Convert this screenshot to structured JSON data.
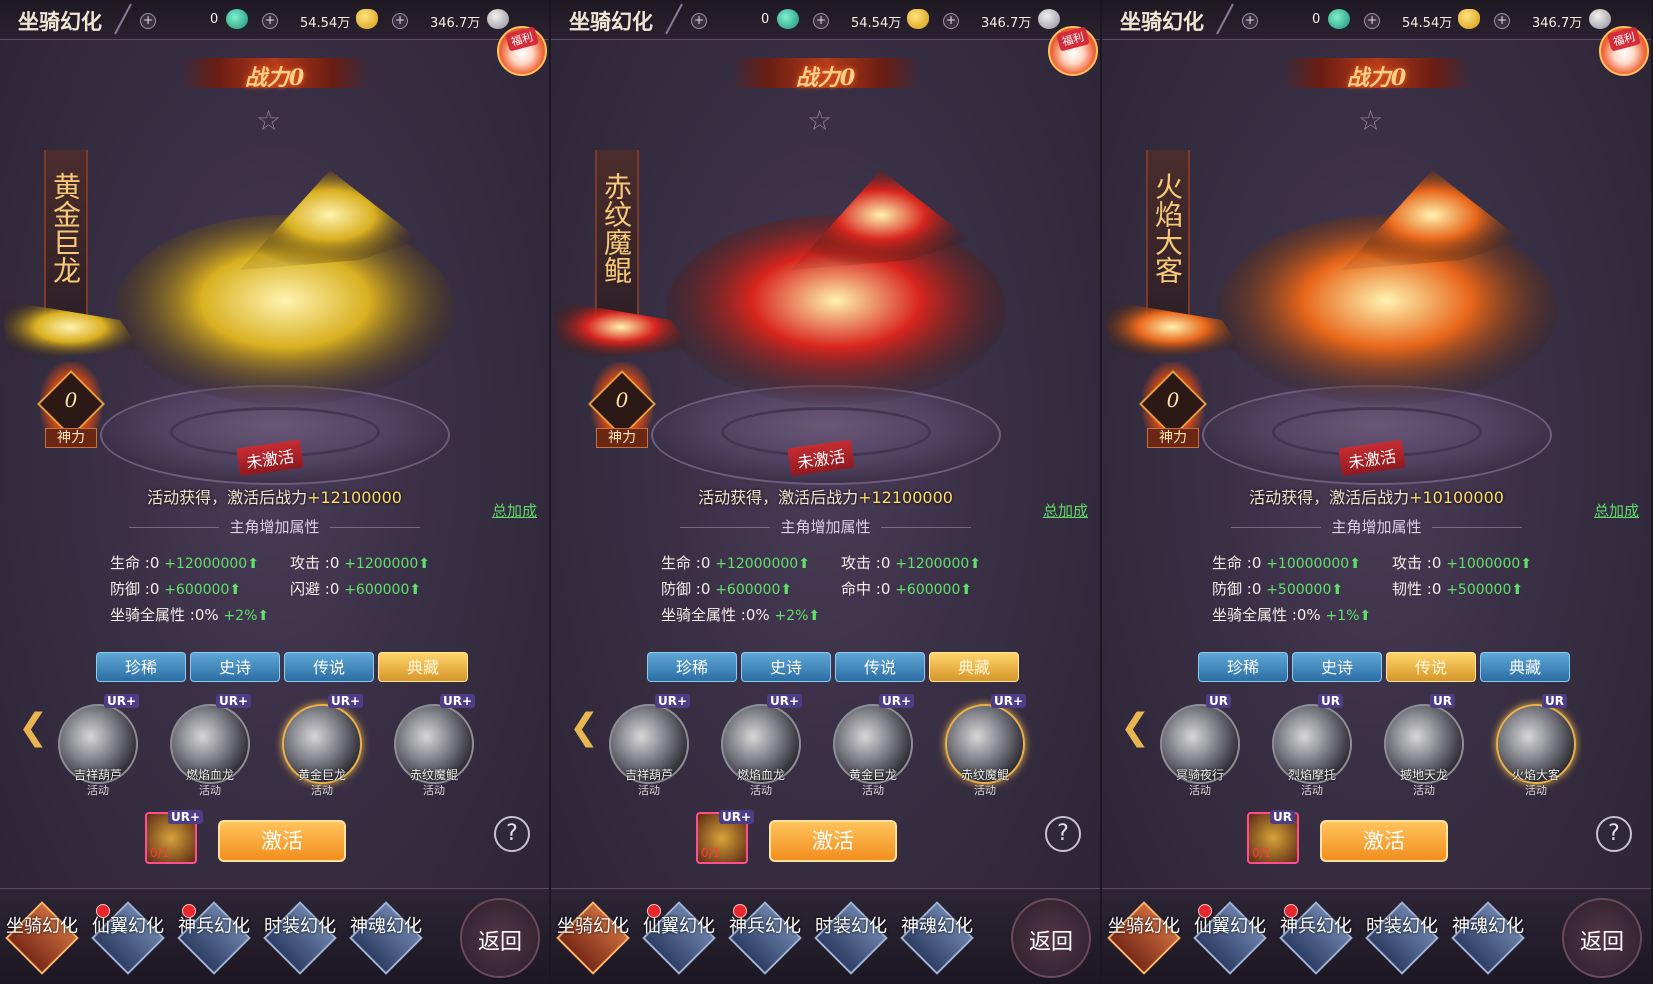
{
  "panels": [
    {
      "title": "坐骑幻化",
      "currency": {
        "jade": "0",
        "ingot": "54.54万",
        "coin": "346.7万"
      },
      "welfare_label": "福利",
      "power": "战力0",
      "mount_name": "黄金巨龙",
      "shenli_value": "0",
      "shenli_label": "神力",
      "status": "未激活",
      "obtain_prefix": "活动获得，激活后战力",
      "obtain_value": "+12100000",
      "total_bonus": "总加成",
      "attr_title": "主角增加属性",
      "stats": {
        "hp_label": "生命",
        "hp_base": ":0",
        "hp_bonus": "+12000000",
        "atk_label": "攻击",
        "atk_base": ":0",
        "atk_bonus": "+1200000",
        "def_label": "防御",
        "def_base": ":0",
        "def_bonus": "+600000",
        "s4_label": "闪避",
        "s4_base": ":0",
        "s4_bonus": "+600000",
        "all_label": "坐骑全属性",
        "all_base": ":0%",
        "all_bonus": "+2%"
      },
      "tabs": [
        "珍稀",
        "史诗",
        "传说",
        "典藏"
      ],
      "active_tab": 3,
      "mounts": [
        {
          "badge": "UR+",
          "name": "吉祥葫芦",
          "source": "活动"
        },
        {
          "badge": "UR+",
          "name": "燃焰血龙",
          "source": "活动"
        },
        {
          "badge": "UR+",
          "name": "黄金巨龙",
          "source": "活动"
        },
        {
          "badge": "UR+",
          "name": "赤纹魔鲲",
          "source": "活动"
        }
      ],
      "selected_mount": 2,
      "item_badge": "UR+",
      "item_count": "0/1",
      "activate_label": "激活",
      "help_label": "?",
      "nav": [
        "坐骑幻化",
        "仙翼幻化",
        "神兵幻化",
        "时装幻化",
        "神魂幻化"
      ],
      "back_label": "返回",
      "art_color": "#d9b020"
    },
    {
      "title": "坐骑幻化",
      "currency": {
        "jade": "0",
        "ingot": "54.54万",
        "coin": "346.7万"
      },
      "welfare_label": "福利",
      "power": "战力0",
      "mount_name": "赤纹魔鲲",
      "shenli_value": "0",
      "shenli_label": "神力",
      "status": "未激活",
      "obtain_prefix": "活动获得，激活后战力",
      "obtain_value": "+12100000",
      "total_bonus": "总加成",
      "attr_title": "主角增加属性",
      "stats": {
        "hp_label": "生命",
        "hp_base": ":0",
        "hp_bonus": "+12000000",
        "atk_label": "攻击",
        "atk_base": ":0",
        "atk_bonus": "+1200000",
        "def_label": "防御",
        "def_base": ":0",
        "def_bonus": "+600000",
        "s4_label": "命中",
        "s4_base": ":0",
        "s4_bonus": "+600000",
        "all_label": "坐骑全属性",
        "all_base": ":0%",
        "all_bonus": "+2%"
      },
      "tabs": [
        "珍稀",
        "史诗",
        "传说",
        "典藏"
      ],
      "active_tab": 3,
      "mounts": [
        {
          "badge": "UR+",
          "name": "吉祥葫芦",
          "source": "活动"
        },
        {
          "badge": "UR+",
          "name": "燃焰血龙",
          "source": "活动"
        },
        {
          "badge": "UR+",
          "name": "黄金巨龙",
          "source": "活动"
        },
        {
          "badge": "UR+",
          "name": "赤纹魔鲲",
          "source": "活动"
        }
      ],
      "selected_mount": 3,
      "item_badge": "UR+",
      "item_count": "0/1",
      "activate_label": "激活",
      "help_label": "?",
      "nav": [
        "坐骑幻化",
        "仙翼幻化",
        "神兵幻化",
        "时装幻化",
        "神魂幻化"
      ],
      "back_label": "返回",
      "art_color": "#d8251e"
    },
    {
      "title": "坐骑幻化",
      "currency": {
        "jade": "0",
        "ingot": "54.54万",
        "coin": "346.7万"
      },
      "welfare_label": "福利",
      "power": "战力0",
      "mount_name": "火焰大客",
      "shenli_value": "0",
      "shenli_label": "神力",
      "status": "未激活",
      "obtain_prefix": "活动获得，激活后战力",
      "obtain_value": "+10100000",
      "total_bonus": "总加成",
      "attr_title": "主角增加属性",
      "stats": {
        "hp_label": "生命",
        "hp_base": ":0",
        "hp_bonus": "+10000000",
        "atk_label": "攻击",
        "atk_base": ":0",
        "atk_bonus": "+1000000",
        "def_label": "防御",
        "def_base": ":0",
        "def_bonus": "+500000",
        "s4_label": "韧性",
        "s4_base": ":0",
        "s4_bonus": "+500000",
        "all_label": "坐骑全属性",
        "all_base": ":0%",
        "all_bonus": "+1%"
      },
      "tabs": [
        "珍稀",
        "史诗",
        "传说",
        "典藏"
      ],
      "active_tab": 2,
      "mounts": [
        {
          "badge": "UR",
          "name": "冥骑夜行",
          "source": "活动"
        },
        {
          "badge": "UR",
          "name": "烈焰摩托",
          "source": "活动"
        },
        {
          "badge": "UR",
          "name": "撼地天龙",
          "source": "活动"
        },
        {
          "badge": "UR",
          "name": "火焰大客",
          "source": "活动"
        }
      ],
      "selected_mount": 3,
      "item_badge": "UR",
      "item_count": "0/1",
      "activate_label": "激活",
      "help_label": "?",
      "nav": [
        "坐骑幻化",
        "仙翼幻化",
        "神兵幻化",
        "时装幻化",
        "神魂幻化"
      ],
      "back_label": "返回",
      "art_color": "#e8661a"
    }
  ]
}
